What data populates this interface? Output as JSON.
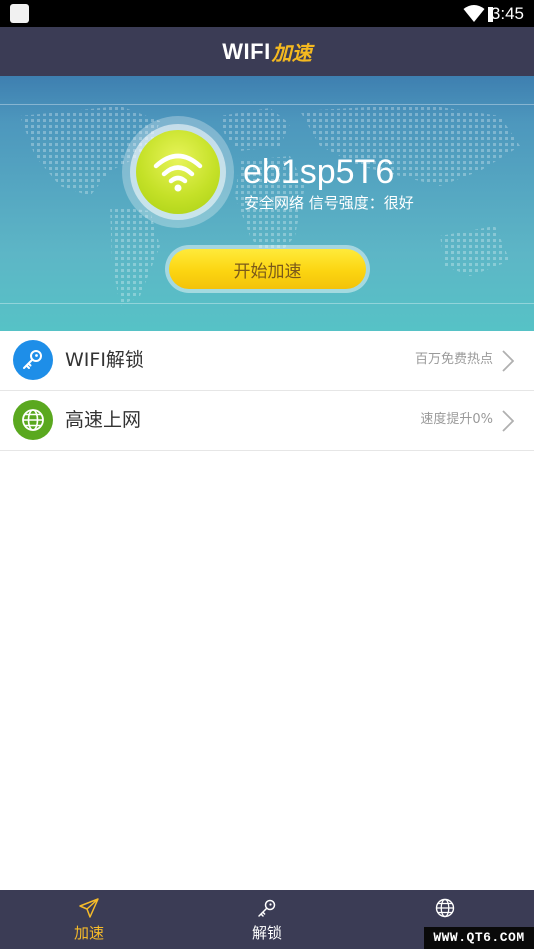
{
  "status_bar": {
    "time": "3:45",
    "icons": [
      "notification-icon",
      "wifi-signal-icon",
      "cell-signal-icon"
    ]
  },
  "header": {
    "title_main": "WIFI",
    "title_accent": "加速"
  },
  "hero": {
    "ssid": "eb1sp5T6",
    "signal_text": "安全网络 信号强度：很好",
    "start_button": "开始加速",
    "icon": "wifi-icon"
  },
  "list": [
    {
      "label": "WIFI解锁",
      "hint": "百万免费热点",
      "icon": "key-icon",
      "icon_color": "#1e8ee8"
    },
    {
      "label": "高速上网",
      "hint": "速度提升0%",
      "icon": "globe-icon",
      "icon_color": "#5aa81f"
    }
  ],
  "tabs": [
    {
      "label": "加速",
      "icon": "paper-plane-icon",
      "active": true
    },
    {
      "label": "解锁",
      "icon": "key-icon",
      "active": false
    },
    {
      "label": "",
      "icon": "globe-icon",
      "active": false
    }
  ],
  "colors": {
    "header_bg": "#3b3c55",
    "accent": "#f4b920",
    "hero_top": "#3e7fb0",
    "hero_bottom": "#56c2c6"
  },
  "watermark": "WWW.QT6.COM"
}
